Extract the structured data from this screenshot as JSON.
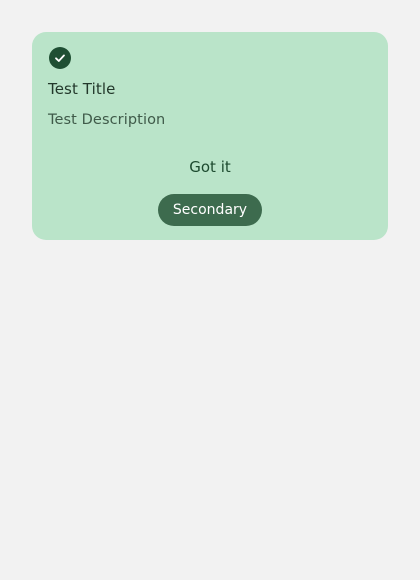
{
  "card": {
    "icon": "check-circle-icon",
    "title": "Test Title",
    "description": "Test Description",
    "primary_label": "Got it",
    "secondary_label": "Secondary"
  },
  "colors": {
    "background": "#f2f2f2",
    "card": "#bae4c9",
    "icon": "#1f4f33",
    "secondary_button": "#3d6b4e"
  }
}
